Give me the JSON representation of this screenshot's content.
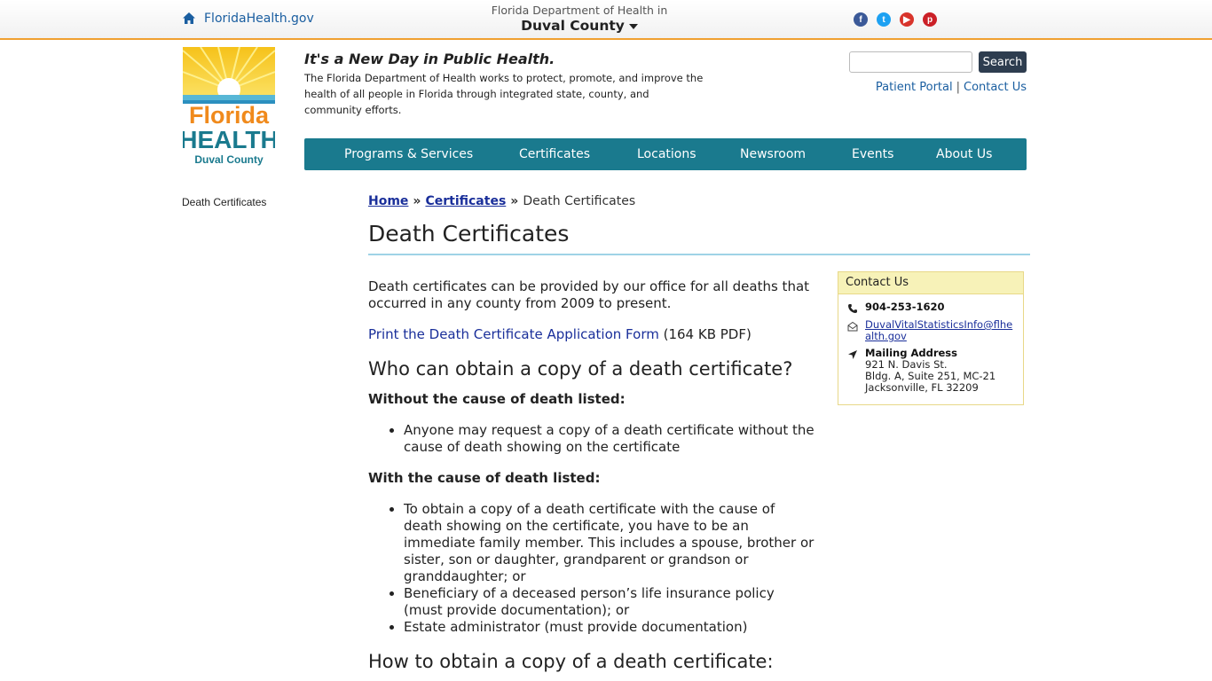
{
  "topbar": {
    "home_label": "FloridaHealth.gov",
    "county_prefix": "Florida Department of Health in",
    "county_name": "Duval County",
    "social": [
      "facebook-icon",
      "twitter-icon",
      "youtube-icon",
      "pinterest-icon"
    ]
  },
  "header": {
    "logo_text": [
      "Florida",
      "HEALTH",
      "Duval County"
    ],
    "tagline": "It's a New Day in Public Health.",
    "mission": "The Florida Department of Health works to protect, promote, and improve the health of all people in Florida through integrated state, county, and community efforts.",
    "search_button": "Search",
    "search_placeholder": "",
    "patient_portal": "Patient Portal",
    "separator": "|",
    "contact_us": "Contact Us"
  },
  "nav": [
    "Programs & Services",
    "Certificates",
    "Locations",
    "Newsroom",
    "Events",
    "About Us"
  ],
  "sidenav": [
    "Death Certificates"
  ],
  "breadcrumb": {
    "home": "Home",
    "certificates": "Certificates",
    "sep": "»",
    "current": "Death Certificates"
  },
  "page_title": "Death Certificates",
  "content": {
    "intro": "Death certificates can be provided by our office for all deaths that occurred in any county from 2009 to present.",
    "form_link": "Print the Death Certificate Application Form",
    "form_size": " (164 KB PDF)",
    "h_who": "Who can obtain a copy of a death certificate?",
    "h_without": "Without the cause of death listed:",
    "without_items": [
      "Anyone may request a copy of a death certificate without the cause of death showing on the certificate"
    ],
    "h_with": "With the cause of death listed:",
    "with_items": [
      "To obtain a copy of a death certificate with the cause of death showing on the certificate, you have to be an immediate family member. This includes a spouse, brother or sister, son or daughter, grandparent or grandson or granddaughter; or",
      "Beneficiary of a deceased person’s life insurance policy (must provide documentation); or",
      "Estate administrator (must provide documentation)"
    ],
    "h_how": "How to obtain a copy of a death certificate:"
  },
  "contact_box": {
    "title": "Contact Us",
    "phone": "904-253-1620",
    "email": "DuvalVitalStatisticsInfo@flhealth.gov",
    "mail_label": "Mailing Address",
    "address_lines": [
      "921 N. Davis St.",
      "Bldg. A, Suite 251, MC-21",
      "Jacksonville, FL 32209"
    ]
  },
  "colors": {
    "nav_bg": "#1a7a8e",
    "accent_border": "#f0a030",
    "link": "#1a2f9a",
    "contact_head_bg": "#f7f2b8"
  }
}
